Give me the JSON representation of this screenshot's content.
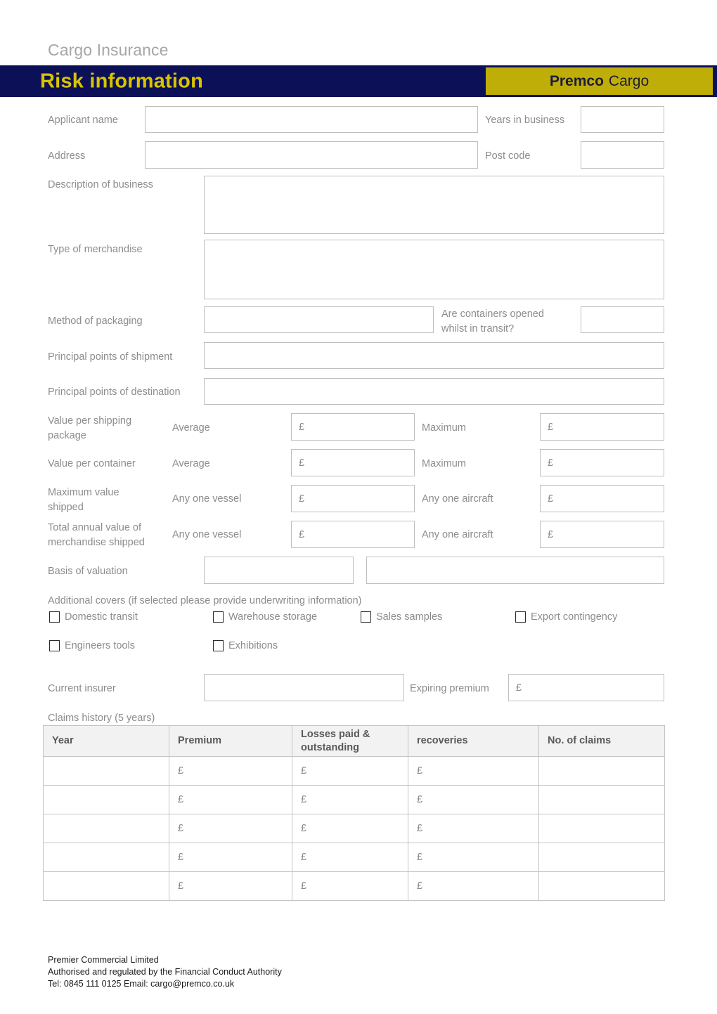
{
  "header": {
    "doc_title": "Cargo Insurance",
    "bar_title": "Risk information",
    "brand_primary": "Premco",
    "brand_secondary": "Cargo",
    "colors": {
      "navy": "#0b1057",
      "yellow_text": "#d9c400",
      "brand_box": "#bfae07",
      "label_gray": "#8c8c8c",
      "box_border": "#bfbfbf",
      "table_header_bg": "#f2f2f2"
    }
  },
  "fields": {
    "applicant_name": "Applicant name",
    "years_in_business": "Years in business",
    "address": "Address",
    "post_code": "Post code",
    "description_of_business": "Description of business",
    "type_of_merchandise": "Type of merchandise",
    "method_of_packaging": "Method of packaging",
    "containers_opened": "Are containers opened\nwhilst in transit?",
    "principal_points_shipment": "Principal points of shipment",
    "principal_points_destination": "Principal points of destination",
    "value_per_shipping_package": "Value per shipping\npackage",
    "value_per_container": "Value per container",
    "maximum_value_shipped": "Maximum value\nshipped",
    "total_annual_value": "Total annual value of\nmerchandise shipped",
    "basis_of_valuation": "Basis of valuation",
    "current_insurer": "Current insurer",
    "expiring_premium": "Expiring premium",
    "average": "Average",
    "maximum": "Maximum",
    "any_one_vessel": "Any one vessel",
    "any_one_aircraft": "Any one aircraft",
    "currency_symbol": "£"
  },
  "additional_covers": {
    "heading": "Additional covers (if selected please provide underwriting information)",
    "options": [
      {
        "label": "Domestic transit",
        "checked": false
      },
      {
        "label": "Warehouse storage",
        "checked": false
      },
      {
        "label": "Sales samples",
        "checked": false
      },
      {
        "label": "Export contingency",
        "checked": false
      },
      {
        "label": "Engineers tools",
        "checked": false
      },
      {
        "label": "Exhibitions",
        "checked": false
      }
    ]
  },
  "claims_history": {
    "heading": "Claims history (5 years)",
    "columns": [
      "Year",
      "Premium",
      "Losses paid &\noutstanding",
      "recoveries",
      "No. of claims"
    ],
    "rows": [
      [
        "",
        "£",
        "£",
        "£",
        ""
      ],
      [
        "",
        "£",
        "£",
        "£",
        ""
      ],
      [
        "",
        "£",
        "£",
        "£",
        ""
      ],
      [
        "",
        "£",
        "£",
        "£",
        ""
      ],
      [
        "",
        "£",
        "£",
        "£",
        ""
      ]
    ]
  },
  "footer": {
    "lines": "Premier Commercial Limited\nAuthorised and regulated by the Financial Conduct Authority\nTel: 0845 111 0125 Email: cargo@premco.co.uk"
  }
}
